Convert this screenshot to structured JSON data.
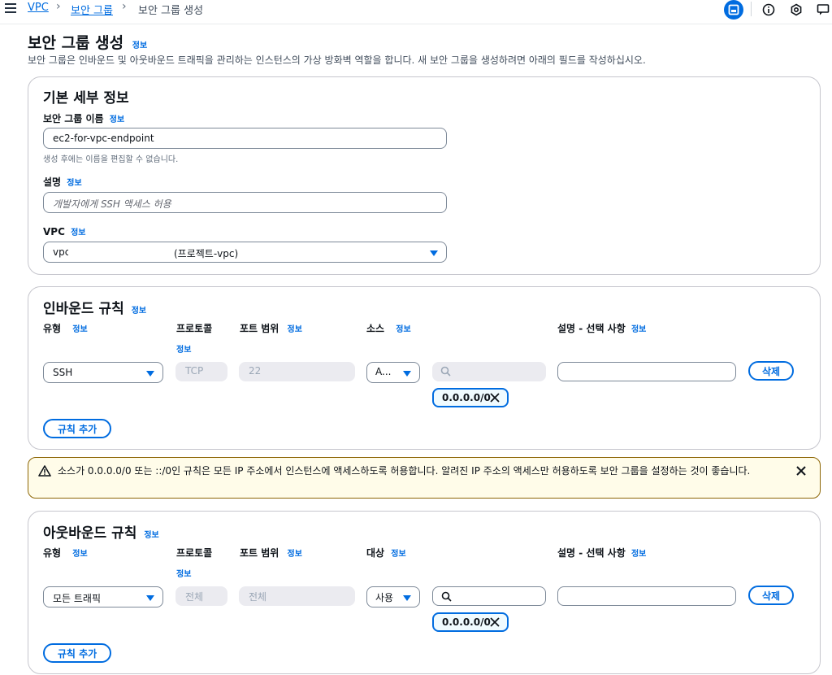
{
  "breadcrumb": {
    "vpc": "VPC",
    "sg": "보안 그룹",
    "current": "보안 그룹 생성",
    "sep": "›"
  },
  "header": {
    "title": "보안 그룹 생성",
    "info": "정보",
    "description": "보안 그룹은 인바운드 및 아웃바운드 트래픽을 관리하는 인스턴스의 가상 방화벽 역할을 합니다. 새 보안 그룹을 생성하려면 아래의 필드를 작성하십시오."
  },
  "basic": {
    "title": "기본 세부 정보",
    "name_label": "보안 그룹 이름",
    "name_value": "ec2-for-vpc-endpoint",
    "name_hint": "생성 후에는 이름을 편집할 수 없습니다.",
    "desc_label": "설명",
    "desc_placeholder": "개발자에게 SSH 액세스 허용",
    "vpc_label": "VPC",
    "vpc_value_left": "vpc",
    "vpc_value_right": "(프로젝트-vpc)"
  },
  "inbound": {
    "title": "인바운드 규칙",
    "col_type": "유형",
    "col_protocol": "프로토콜",
    "col_port": "포트 범위",
    "col_source": "소스",
    "col_desc": "설명 - 선택 사항",
    "type_value": "SSH",
    "protocol_value": "TCP",
    "port_value": "22",
    "source_value": "A...",
    "token": "0.0.0.0/0",
    "delete": "삭제",
    "add": "규칙 추가"
  },
  "alert": {
    "text": "소스가 0.0.0.0/0 또는 ::/0인 규칙은 모든 IP 주소에서 인스턴스에 액세스하도록 허용합니다. 알려진 IP 주소의 액세스만 허용하도록 보안 그룹을 설정하는 것이 좋습니다."
  },
  "outbound": {
    "title": "아웃바운드 규칙",
    "col_type": "유형",
    "col_protocol": "프로토콜",
    "col_port": "포트 범위",
    "col_dest": "대상",
    "col_desc": "설명 - 선택 사항",
    "type_value": "모든 트래픽",
    "protocol_value": "전체",
    "port_value": "전체",
    "dest_value": "사용",
    "token": "0.0.0.0/0",
    "delete": "삭제",
    "add": "규칙 추가"
  },
  "colors": {
    "accent": "#006ce0",
    "warning_border": "#8d6605",
    "warning_bg": "#fffce9"
  }
}
